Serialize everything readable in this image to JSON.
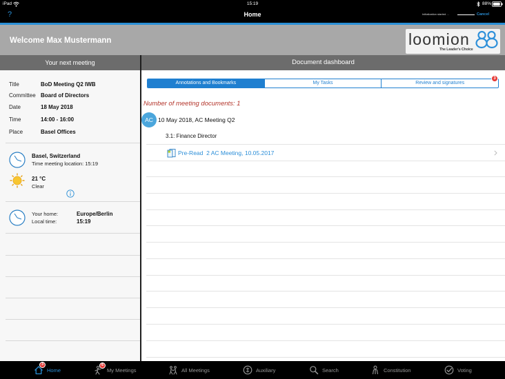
{
  "status_bar": {
    "device": "iPad",
    "time": "15:19",
    "battery": "88%"
  },
  "nav_bar": {
    "help": "?",
    "title": "Home",
    "progress_text": "Initialization started ...",
    "cancel": "Cancel"
  },
  "header": {
    "welcome": "Welcome Max Mustermann",
    "logo_text": "loomion",
    "logo_tagline": "The Leader's Choice"
  },
  "left_panel": {
    "title": "Your next meeting",
    "meeting": [
      {
        "label": "Title",
        "value": "BoD Meeting Q2 IWB"
      },
      {
        "label": "Committee",
        "value": "Board of Directors"
      },
      {
        "label": "Date",
        "value": "18 May 2018"
      },
      {
        "label": "Time",
        "value": "14:00 - 16:00"
      },
      {
        "label": "Place",
        "value": "Basel Offices"
      }
    ],
    "location": {
      "city": "Basel, Switzerland",
      "local_time": "Time meeting location: 15:19"
    },
    "weather": {
      "temperature": "21 °C",
      "condition": "Clear",
      "icon": "sun-icon"
    },
    "home": {
      "home_label": "Your home:",
      "home_value": "Europe/Berlin",
      "time_label": "Local time:",
      "time_value": "15:19"
    }
  },
  "right_panel": {
    "title": "Document dashboard",
    "tabs": [
      {
        "label": "Annotations and Bookmarks",
        "selected": true
      },
      {
        "label": "My Tasks",
        "selected": false
      },
      {
        "label": "Review and signatures",
        "selected": false,
        "badge": "3"
      }
    ],
    "document_count": "Number of meeting documents: 1",
    "meeting": {
      "avatar": "AC",
      "title": "10 May 2018, AC Meeting Q2"
    },
    "agenda_item": "3.1: Finance Director",
    "document": {
      "label": "Pre-Read  2 AC Meeting, 10.05.2017",
      "icon": "document-icon"
    }
  },
  "tab_bar": {
    "items": [
      {
        "label": "Home",
        "icon": "home-icon",
        "badge": "3",
        "active": true
      },
      {
        "label": "My Meetings",
        "icon": "my-meetings-icon",
        "badge": "6",
        "active": false
      },
      {
        "label": "All Meetings",
        "icon": "all-meetings-icon",
        "active": false
      },
      {
        "label": "Auxiliary",
        "icon": "auxiliary-icon",
        "active": false
      },
      {
        "label": "Search",
        "icon": "search-icon",
        "active": false
      },
      {
        "label": "Constitution",
        "icon": "constitution-icon",
        "active": false
      },
      {
        "label": "Voting",
        "icon": "voting-icon",
        "active": false
      }
    ]
  },
  "colors": {
    "accent": "#2a8fd6",
    "badge": "#e53935",
    "header_band": "#a8a8a8",
    "section_bar": "#6c6c6c",
    "document_count": "#b3342a",
    "avatar": "#4ba6dc"
  }
}
